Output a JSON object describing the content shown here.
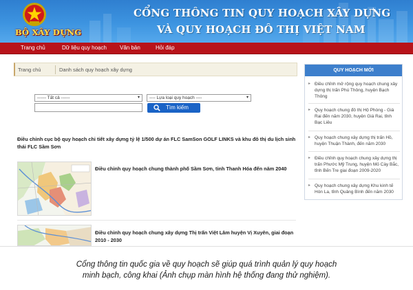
{
  "banner": {
    "ministry": "BỘ XÂY DỰNG",
    "title_line1": "CỔNG THÔNG TIN QUY HOẠCH XÂY DỰNG",
    "title_line2": "VÀ QUY HOẠCH ĐÔ THỊ VIỆT NAM",
    "emblem_icon": "national-emblem-icon"
  },
  "nav": {
    "items": [
      {
        "label": "Trang chủ"
      },
      {
        "label": "Dữ liệu quy hoạch"
      },
      {
        "label": "Văn bản"
      },
      {
        "label": "Hỏi đáp"
      }
    ]
  },
  "breadcrumb": {
    "home": "Trang chủ",
    "current": "Danh sách quy hoạch xây dựng"
  },
  "filters": {
    "select_all": "------ Tất cả ------",
    "select_type": "---- Lựa loại quy hoạch ----",
    "search_value": "",
    "search_button": "Tìm kiếm"
  },
  "main": {
    "headline": "Điều chỉnh cục bộ quy hoạch chi tiết xây dựng tỷ lệ 1/500 dự án FLC SamSon GOLF LINKS và khu đô thị du lịch sinh thái FLC Sầm Sơn",
    "results": [
      {
        "title": "Điều chỉnh quy hoạch chung thành phố Sầm Sơn, tỉnh Thanh Hóa đến năm 2040"
      },
      {
        "title": "Điều chỉnh quy hoạch chung xây dựng Thị trấn Việt Lâm huyện Vị Xuyên, giai đoạn 2010 - 2030"
      }
    ]
  },
  "sidebar": {
    "heading": "QUY HOẠCH MỚI",
    "items": [
      {
        "text": "Điều chỉnh mở rộng quy hoạch chung xây dựng thị trấn Phú Thông, huyện Bạch Thông"
      },
      {
        "text": "Quy hoạch chung đô thị Hộ Phòng - Giá Rai đến năm 2030, huyện Giá Rai, tỉnh Bạc Liêu"
      },
      {
        "text": "Quy hoạch chung xây dựng thị trấn Hồ, huyện Thuận Thành, đến năm 2030"
      },
      {
        "text": "Điều chỉnh quy hoạch chung xây dựng thị trấn Phước Mỹ Trung, huyện Mỏ Cày Bắc, tỉnh Bến Tre giai đoạn 2009-2020"
      },
      {
        "text": "Quy hoạch chung xây dựng Khu kinh tế Hòn La, tỉnh Quảng Bình đến năm 2030"
      }
    ]
  },
  "caption": {
    "line1": "Cổng thông tin quốc gia về quy hoạch sẽ giúp quá trình quản lý quy hoạch",
    "line2": "minh bạch, công khai (Ảnh chụp màn hình hệ thống đang thử nghiệm)."
  },
  "colors": {
    "banner_blue": "#3d94e0",
    "nav_red": "#b8131a",
    "ministry_yellow": "#ffe34a",
    "button_blue": "#1a63c6",
    "sidebar_header_blue": "#3d7fcc"
  }
}
